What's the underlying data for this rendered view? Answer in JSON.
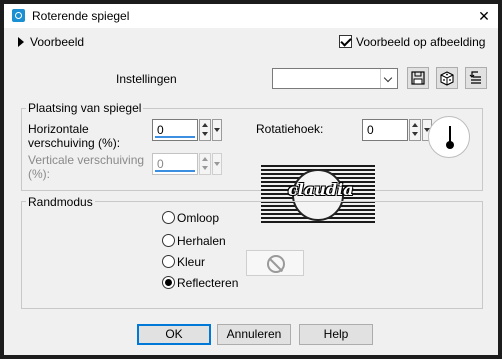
{
  "window": {
    "title": "Roterende spiegel",
    "close_glyph": "✕"
  },
  "preview": {
    "toggle_label": "Voorbeeld",
    "checkbox_label": "Voorbeeld op afbeelding",
    "checkbox_checked": true
  },
  "settings": {
    "label": "Instellingen",
    "dropdown_value": "",
    "tool_icons": [
      "save-preset-icon",
      "random-dice-icon",
      "reset-icon"
    ]
  },
  "mirror_placement": {
    "group_label": "Plaatsing van spiegel",
    "horizontal_label": "Horizontale verschuiving (%):",
    "horizontal_value": "0",
    "vertical_label": "Verticale verschuiving (%):",
    "vertical_value": "0",
    "vertical_enabled": false,
    "rotation_label": "Rotatiehoek:",
    "rotation_value": "0"
  },
  "watermark": {
    "text": "claudia"
  },
  "edge_mode": {
    "group_label": "Randmodus",
    "options": [
      {
        "label": "Omloop",
        "checked": false
      },
      {
        "label": "Herhalen",
        "checked": false
      },
      {
        "label": "Kleur",
        "checked": false
      },
      {
        "label": "Reflecteren",
        "checked": true
      }
    ]
  },
  "buttons": {
    "ok": "OK",
    "cancel": "Annuleren",
    "help": "Help"
  },
  "colors": {
    "accent": "#0078d7",
    "frame": "#1c1c1c",
    "dialog_bg": "#f0f0f0"
  }
}
